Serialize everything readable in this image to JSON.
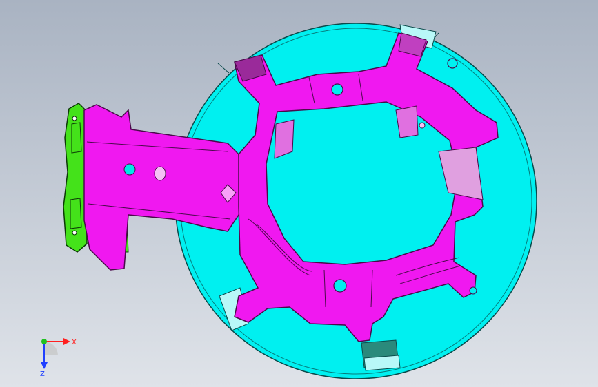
{
  "viewport": {
    "background_top": "#a9b3c2",
    "background_bottom": "#dfe3e9"
  },
  "model": {
    "panel_color": "#00ffff",
    "bracket_color": "#ff00ff",
    "hinge_color": "#33dd11"
  },
  "triad": {
    "x_label": "X",
    "z_label": "Z",
    "x_color": "#ff2020",
    "y_color": "#20c020",
    "z_color": "#2040ff"
  }
}
